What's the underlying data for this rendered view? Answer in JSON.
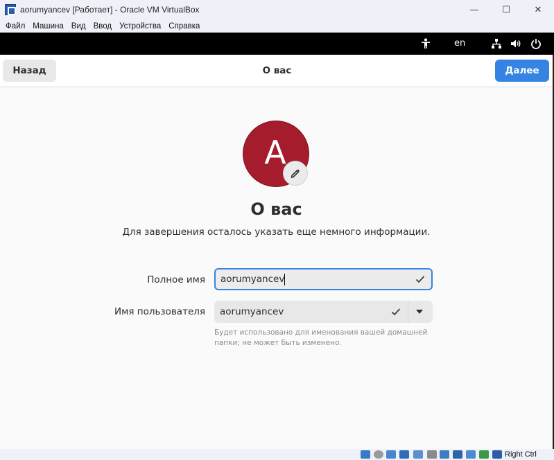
{
  "window": {
    "title": "aorumyancev [Работает] - Oracle VM VirtualBox",
    "minimize_glyph": "—",
    "maximize_glyph": "☐",
    "close_glyph": "✕"
  },
  "menu": [
    "Файл",
    "Машина",
    "Вид",
    "Ввод",
    "Устройства",
    "Справка"
  ],
  "guest_topbar": {
    "language": "en",
    "icons": [
      "accessibility-icon",
      "network-icon",
      "volume-icon",
      "power-icon"
    ]
  },
  "header": {
    "back_label": "Назад",
    "title": "О вас",
    "next_label": "Далее"
  },
  "avatar": {
    "letter": "A",
    "color": "#a51d2d"
  },
  "page": {
    "heading": "О вас",
    "subtitle": "Для завершения осталось указать еще немного информации."
  },
  "form": {
    "full_name_label": "Полное имя",
    "full_name_value": "aorumyancev",
    "username_label": "Имя пользователя",
    "username_value": "aorumyancev",
    "username_hint": "Будет использовано для именования вашей домашней папки; не может быть изменено."
  },
  "statusbar": {
    "host_key": "Right Ctrl"
  },
  "colors": {
    "accent": "#3584e4",
    "avatar": "#a51d2d"
  }
}
